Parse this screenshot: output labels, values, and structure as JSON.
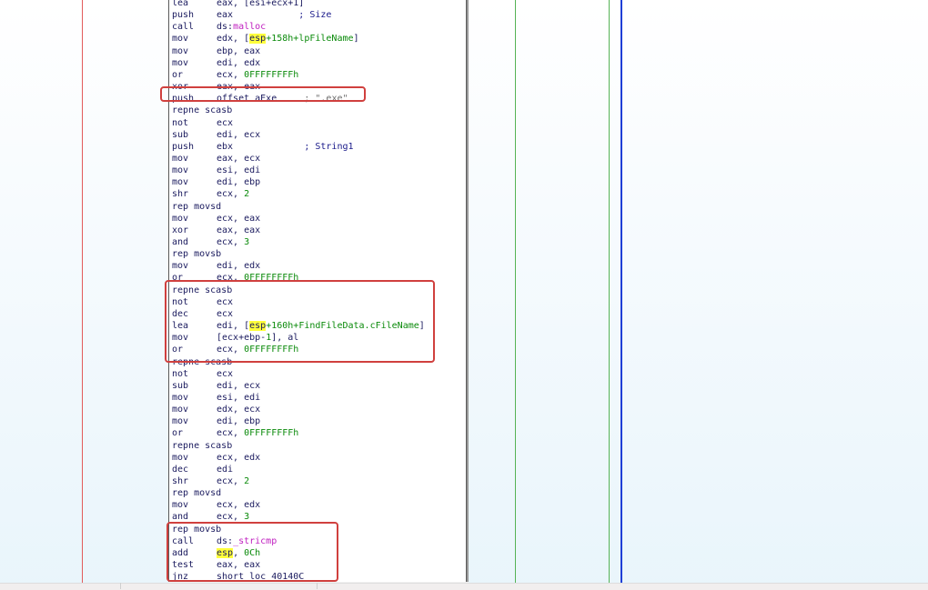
{
  "lines": [
    {
      "mn": "lea",
      "parts": [
        {
          "t": "eax, [esi+ecx+1]",
          "c": "reg"
        }
      ]
    },
    {
      "mn": "push",
      "parts": [
        {
          "t": "eax",
          "c": "reg"
        },
        {
          "t": "            ; Size",
          "c": "cmt"
        }
      ]
    },
    {
      "mn": "call",
      "parts": [
        {
          "t": "ds:",
          "c": "reg"
        },
        {
          "t": "malloc",
          "c": "imp"
        }
      ]
    },
    {
      "mn": "mov",
      "parts": [
        {
          "t": "edx, [",
          "c": "reg"
        },
        {
          "t": "esp",
          "c": "hl"
        },
        {
          "t": "+158h+",
          "c": "num"
        },
        {
          "t": "lpFileName",
          "c": "num"
        },
        {
          "t": "]",
          "c": "reg"
        }
      ]
    },
    {
      "mn": "mov",
      "parts": [
        {
          "t": "ebp, eax",
          "c": "reg"
        }
      ]
    },
    {
      "mn": "mov",
      "parts": [
        {
          "t": "edi, edx",
          "c": "reg"
        }
      ]
    },
    {
      "mn": "or",
      "parts": [
        {
          "t": "ecx, ",
          "c": "reg"
        },
        {
          "t": "0FFFFFFFFh",
          "c": "num"
        }
      ]
    },
    {
      "mn": "xor",
      "parts": [
        {
          "t": "eax, eax",
          "c": "reg"
        }
      ]
    },
    {
      "mn": "push",
      "parts": [
        {
          "t": "offset aExe",
          "c": "reg"
        },
        {
          "t": "     ; \".exe\"",
          "c": "str"
        }
      ]
    },
    {
      "mn": "repne scasb",
      "parts": []
    },
    {
      "mn": "not",
      "parts": [
        {
          "t": "ecx",
          "c": "reg"
        }
      ]
    },
    {
      "mn": "sub",
      "parts": [
        {
          "t": "edi, ecx",
          "c": "reg"
        }
      ]
    },
    {
      "mn": "push",
      "parts": [
        {
          "t": "ebx",
          "c": "reg"
        },
        {
          "t": "             ; String1",
          "c": "cmt"
        }
      ]
    },
    {
      "mn": "mov",
      "parts": [
        {
          "t": "eax, ecx",
          "c": "reg"
        }
      ]
    },
    {
      "mn": "mov",
      "parts": [
        {
          "t": "esi, edi",
          "c": "reg"
        }
      ]
    },
    {
      "mn": "mov",
      "parts": [
        {
          "t": "edi, ebp",
          "c": "reg"
        }
      ]
    },
    {
      "mn": "shr",
      "parts": [
        {
          "t": "ecx, ",
          "c": "reg"
        },
        {
          "t": "2",
          "c": "num"
        }
      ]
    },
    {
      "mn": "rep movsd",
      "parts": []
    },
    {
      "mn": "mov",
      "parts": [
        {
          "t": "ecx, eax",
          "c": "reg"
        }
      ]
    },
    {
      "mn": "xor",
      "parts": [
        {
          "t": "eax, eax",
          "c": "reg"
        }
      ]
    },
    {
      "mn": "and",
      "parts": [
        {
          "t": "ecx, ",
          "c": "reg"
        },
        {
          "t": "3",
          "c": "num"
        }
      ]
    },
    {
      "mn": "rep movsb",
      "parts": []
    },
    {
      "mn": "mov",
      "parts": [
        {
          "t": "edi, edx",
          "c": "reg"
        }
      ]
    },
    {
      "mn": "or",
      "parts": [
        {
          "t": "ecx, ",
          "c": "reg"
        },
        {
          "t": "0FFFFFFFFh",
          "c": "num"
        }
      ]
    },
    {
      "mn": "repne scasb",
      "parts": []
    },
    {
      "mn": "not",
      "parts": [
        {
          "t": "ecx",
          "c": "reg"
        }
      ]
    },
    {
      "mn": "dec",
      "parts": [
        {
          "t": "ecx",
          "c": "reg"
        }
      ]
    },
    {
      "mn": "lea",
      "parts": [
        {
          "t": "edi, [",
          "c": "reg"
        },
        {
          "t": "esp",
          "c": "hl"
        },
        {
          "t": "+160h+",
          "c": "num"
        },
        {
          "t": "FindFileData.cFileName",
          "c": "num"
        },
        {
          "t": "]",
          "c": "reg"
        }
      ]
    },
    {
      "mn": "mov",
      "parts": [
        {
          "t": "[ecx+ebp-",
          "c": "reg"
        },
        {
          "t": "1",
          "c": "num"
        },
        {
          "t": "], al",
          "c": "reg"
        }
      ]
    },
    {
      "mn": "or",
      "parts": [
        {
          "t": "ecx, ",
          "c": "reg"
        },
        {
          "t": "0FFFFFFFFh",
          "c": "num"
        }
      ]
    },
    {
      "mn": "repne scasb",
      "parts": []
    },
    {
      "mn": "not",
      "parts": [
        {
          "t": "ecx",
          "c": "reg"
        }
      ]
    },
    {
      "mn": "sub",
      "parts": [
        {
          "t": "edi, ecx",
          "c": "reg"
        }
      ]
    },
    {
      "mn": "mov",
      "parts": [
        {
          "t": "esi, edi",
          "c": "reg"
        }
      ]
    },
    {
      "mn": "mov",
      "parts": [
        {
          "t": "edx, ecx",
          "c": "reg"
        }
      ]
    },
    {
      "mn": "mov",
      "parts": [
        {
          "t": "edi, ebp",
          "c": "reg"
        }
      ]
    },
    {
      "mn": "or",
      "parts": [
        {
          "t": "ecx, ",
          "c": "reg"
        },
        {
          "t": "0FFFFFFFFh",
          "c": "num"
        }
      ]
    },
    {
      "mn": "repne scasb",
      "parts": []
    },
    {
      "mn": "mov",
      "parts": [
        {
          "t": "ecx, edx",
          "c": "reg"
        }
      ]
    },
    {
      "mn": "dec",
      "parts": [
        {
          "t": "edi",
          "c": "reg"
        }
      ]
    },
    {
      "mn": "shr",
      "parts": [
        {
          "t": "ecx, ",
          "c": "reg"
        },
        {
          "t": "2",
          "c": "num"
        }
      ]
    },
    {
      "mn": "rep movsd",
      "parts": []
    },
    {
      "mn": "mov",
      "parts": [
        {
          "t": "ecx, edx",
          "c": "reg"
        }
      ]
    },
    {
      "mn": "and",
      "parts": [
        {
          "t": "ecx, ",
          "c": "reg"
        },
        {
          "t": "3",
          "c": "num"
        }
      ]
    },
    {
      "mn": "rep movsb",
      "parts": []
    },
    {
      "mn": "call",
      "parts": [
        {
          "t": "ds:",
          "c": "reg"
        },
        {
          "t": "_stricmp",
          "c": "imp"
        }
      ]
    },
    {
      "mn": "add",
      "parts": [
        {
          "t": "esp",
          "c": "hl"
        },
        {
          "t": ", ",
          "c": "reg"
        },
        {
          "t": "0Ch",
          "c": "num"
        }
      ]
    },
    {
      "mn": "test",
      "parts": [
        {
          "t": "eax, eax",
          "c": "reg"
        }
      ]
    },
    {
      "mn": "jnz",
      "parts": [
        {
          "t": "short loc_40140C",
          "c": "reg"
        }
      ]
    }
  ],
  "colors": {
    "accent_box": "#d0403e",
    "highlight": "#ffff3c",
    "edge_red": "#e25b5b",
    "edge_green": "#56b356",
    "edge_blue": "#1f3fd6"
  }
}
